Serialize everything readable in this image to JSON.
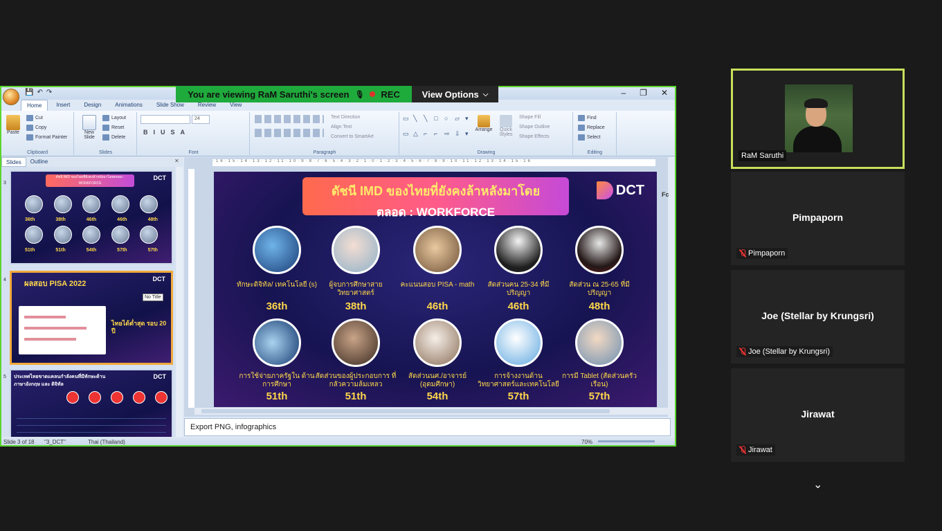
{
  "share_banner": {
    "text": "You are viewing  RaM Saruthi's screen",
    "rec": "REC"
  },
  "view_options": {
    "label": "View Options"
  },
  "ppt": {
    "tabs": [
      "Home",
      "Insert",
      "Design",
      "Animations",
      "Slide Show",
      "Review",
      "View"
    ],
    "clipboard": {
      "paste": "Paste",
      "cut": "Cut",
      "copy": "Copy",
      "format_painter": "Format Painter",
      "label": "Clipboard"
    },
    "slides_group": {
      "new_slide": "New Slide",
      "layout": "Layout",
      "reset": "Reset",
      "delete": "Delete",
      "label": "Slides"
    },
    "font": {
      "size": "24",
      "label": "Font"
    },
    "paragraph": {
      "text_direction": "Text Direction",
      "align_text": "Align Text",
      "convert": "Convert to SmartArt",
      "label": "Paragraph"
    },
    "drawing": {
      "arrange": "Arrange",
      "quick_styles": "Quick Styles",
      "shape_fill": "Shape Fill",
      "shape_outline": "Shape Outline",
      "shape_effects": "Shape Effects",
      "label": "Drawing"
    },
    "editing": {
      "find": "Find",
      "replace": "Replace",
      "select": "Select",
      "label": "Editing"
    },
    "pane_tabs": {
      "slides": "Slides",
      "outline": "Outline"
    },
    "thumbs": {
      "s3": {
        "num": "3",
        "title": "ดัชนี IMD ของไทยที่ยังคงล้าหลังมาโดยตลอด : WORKFORCE",
        "ranks": [
          "36th",
          "38th",
          "46th",
          "46th",
          "48th"
        ],
        "ranks2": [
          "51th",
          "51th",
          "54th",
          "57th",
          "57th"
        ]
      },
      "s4": {
        "num": "4",
        "title": "ผลสอบ PISA 2022",
        "text": "ไทยได้ต่ำสุด รอบ 20 ปี"
      },
      "s5": {
        "num": "5",
        "title": "ประเทศไทยขาดแคลนกำลังคนที่มีทักษะด้าน ภาษาอังกฤษ และ ดิจิทัล"
      }
    },
    "tooltip": "No Title",
    "slide": {
      "title_line1": "ดัชนี IMD ของไทยที่ยังคงล้าหลังมาโดย",
      "title_line2": "ตลอด : WORKFORCE",
      "logo": "DCT",
      "row1": [
        {
          "label": "ทักษะดิจิทัล/ เทคโนโลยี (s)",
          "rank": "36th"
        },
        {
          "label": "ผู้จบการศึกษาสาย วิทยาศาสตร์",
          "rank": "38th"
        },
        {
          "label": "คะแนนสอบ PISA - math",
          "rank": "46th"
        },
        {
          "label": "สัดส่วนคน 25-34 ที่มีปริญญา",
          "rank": "46th"
        },
        {
          "label": "สัดส่วน ณ 25-65 ที่มีปริญญา",
          "rank": "48th"
        }
      ],
      "row2": [
        {
          "label": "การใช้จ่ายภาครัฐใน ด้านการศึกษา",
          "rank": "51th"
        },
        {
          "label": "สัดส่วนของผู้ประกอบการ ที่กลัวความล้มเหลว",
          "rank": "51th"
        },
        {
          "label": "สัดส่วนนศ./อาจารย์ (อุดมศึกษา)",
          "rank": "54th"
        },
        {
          "label": "การจ้างงานด้าน วิทยาศาสตร์และเทคโนโลยี",
          "rank": "57th"
        },
        {
          "label": "การมี Tablet (สัดส่วนครัวเรือน)",
          "rank": "57th"
        }
      ]
    },
    "side_label": "Fc",
    "notes": "Export PNG, infographics",
    "status": {
      "slide": "Slide 3 of 18",
      "theme": "\"3_DCT\"",
      "lang": "Thai (Thailand)",
      "zoom": "70%"
    }
  },
  "participants": [
    {
      "name": "RaM Saruthi",
      "active": true
    },
    {
      "name": "Pimpaporn",
      "tag": "Pimpaporn"
    },
    {
      "name": "Joe (Stellar by Krungsri)",
      "tag": "Joe (Stellar by Krungsri)"
    },
    {
      "name": "Jirawat",
      "tag": "Jirawat"
    }
  ]
}
